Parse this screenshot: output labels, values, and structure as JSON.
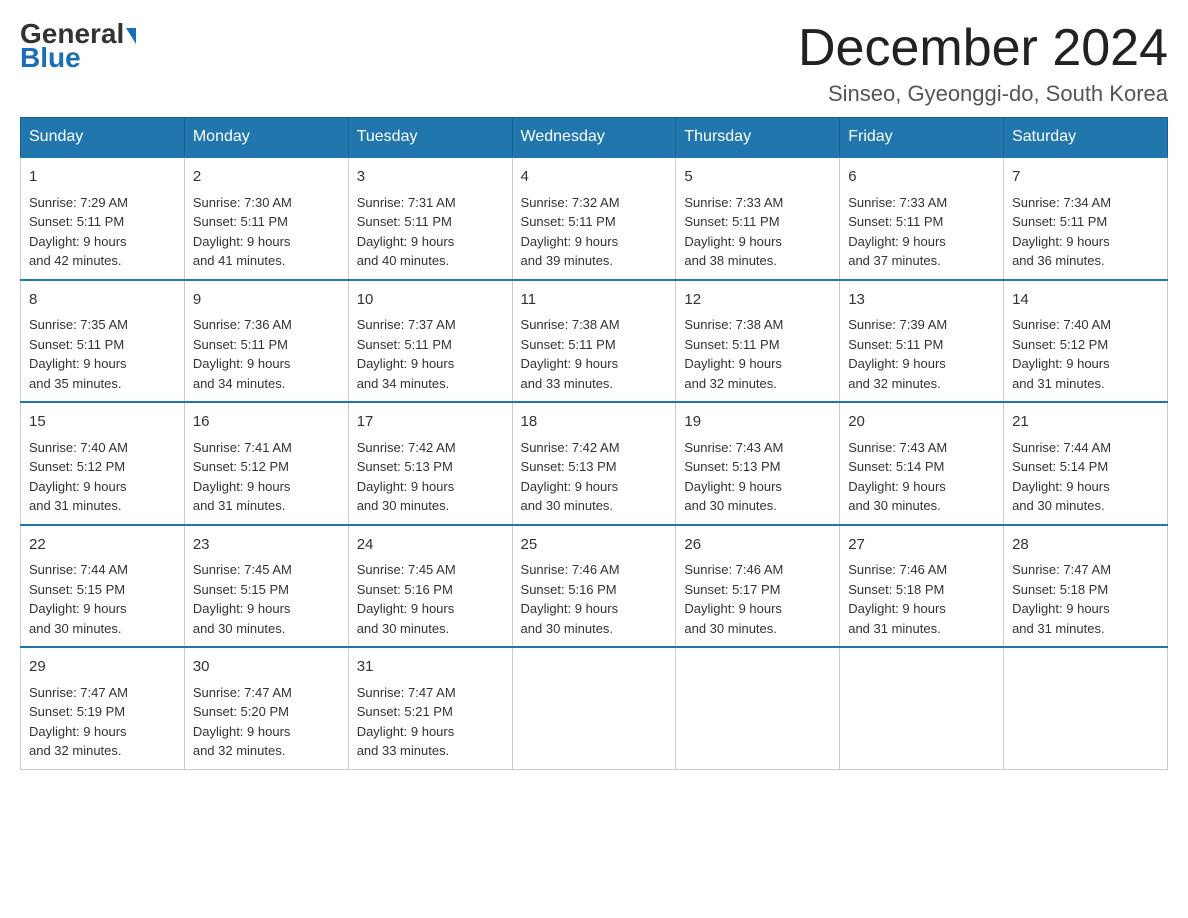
{
  "logo": {
    "general": "General",
    "blue": "Blue"
  },
  "header": {
    "month": "December 2024",
    "location": "Sinseo, Gyeonggi-do, South Korea"
  },
  "days": [
    "Sunday",
    "Monday",
    "Tuesday",
    "Wednesday",
    "Thursday",
    "Friday",
    "Saturday"
  ],
  "weeks": [
    [
      {
        "day": "1",
        "sunrise": "7:29 AM",
        "sunset": "5:11 PM",
        "daylight": "9 hours and 42 minutes."
      },
      {
        "day": "2",
        "sunrise": "7:30 AM",
        "sunset": "5:11 PM",
        "daylight": "9 hours and 41 minutes."
      },
      {
        "day": "3",
        "sunrise": "7:31 AM",
        "sunset": "5:11 PM",
        "daylight": "9 hours and 40 minutes."
      },
      {
        "day": "4",
        "sunrise": "7:32 AM",
        "sunset": "5:11 PM",
        "daylight": "9 hours and 39 minutes."
      },
      {
        "day": "5",
        "sunrise": "7:33 AM",
        "sunset": "5:11 PM",
        "daylight": "9 hours and 38 minutes."
      },
      {
        "day": "6",
        "sunrise": "7:33 AM",
        "sunset": "5:11 PM",
        "daylight": "9 hours and 37 minutes."
      },
      {
        "day": "7",
        "sunrise": "7:34 AM",
        "sunset": "5:11 PM",
        "daylight": "9 hours and 36 minutes."
      }
    ],
    [
      {
        "day": "8",
        "sunrise": "7:35 AM",
        "sunset": "5:11 PM",
        "daylight": "9 hours and 35 minutes."
      },
      {
        "day": "9",
        "sunrise": "7:36 AM",
        "sunset": "5:11 PM",
        "daylight": "9 hours and 34 minutes."
      },
      {
        "day": "10",
        "sunrise": "7:37 AM",
        "sunset": "5:11 PM",
        "daylight": "9 hours and 34 minutes."
      },
      {
        "day": "11",
        "sunrise": "7:38 AM",
        "sunset": "5:11 PM",
        "daylight": "9 hours and 33 minutes."
      },
      {
        "day": "12",
        "sunrise": "7:38 AM",
        "sunset": "5:11 PM",
        "daylight": "9 hours and 32 minutes."
      },
      {
        "day": "13",
        "sunrise": "7:39 AM",
        "sunset": "5:11 PM",
        "daylight": "9 hours and 32 minutes."
      },
      {
        "day": "14",
        "sunrise": "7:40 AM",
        "sunset": "5:12 PM",
        "daylight": "9 hours and 31 minutes."
      }
    ],
    [
      {
        "day": "15",
        "sunrise": "7:40 AM",
        "sunset": "5:12 PM",
        "daylight": "9 hours and 31 minutes."
      },
      {
        "day": "16",
        "sunrise": "7:41 AM",
        "sunset": "5:12 PM",
        "daylight": "9 hours and 31 minutes."
      },
      {
        "day": "17",
        "sunrise": "7:42 AM",
        "sunset": "5:13 PM",
        "daylight": "9 hours and 30 minutes."
      },
      {
        "day": "18",
        "sunrise": "7:42 AM",
        "sunset": "5:13 PM",
        "daylight": "9 hours and 30 minutes."
      },
      {
        "day": "19",
        "sunrise": "7:43 AM",
        "sunset": "5:13 PM",
        "daylight": "9 hours and 30 minutes."
      },
      {
        "day": "20",
        "sunrise": "7:43 AM",
        "sunset": "5:14 PM",
        "daylight": "9 hours and 30 minutes."
      },
      {
        "day": "21",
        "sunrise": "7:44 AM",
        "sunset": "5:14 PM",
        "daylight": "9 hours and 30 minutes."
      }
    ],
    [
      {
        "day": "22",
        "sunrise": "7:44 AM",
        "sunset": "5:15 PM",
        "daylight": "9 hours and 30 minutes."
      },
      {
        "day": "23",
        "sunrise": "7:45 AM",
        "sunset": "5:15 PM",
        "daylight": "9 hours and 30 minutes."
      },
      {
        "day": "24",
        "sunrise": "7:45 AM",
        "sunset": "5:16 PM",
        "daylight": "9 hours and 30 minutes."
      },
      {
        "day": "25",
        "sunrise": "7:46 AM",
        "sunset": "5:16 PM",
        "daylight": "9 hours and 30 minutes."
      },
      {
        "day": "26",
        "sunrise": "7:46 AM",
        "sunset": "5:17 PM",
        "daylight": "9 hours and 30 minutes."
      },
      {
        "day": "27",
        "sunrise": "7:46 AM",
        "sunset": "5:18 PM",
        "daylight": "9 hours and 31 minutes."
      },
      {
        "day": "28",
        "sunrise": "7:47 AM",
        "sunset": "5:18 PM",
        "daylight": "9 hours and 31 minutes."
      }
    ],
    [
      {
        "day": "29",
        "sunrise": "7:47 AM",
        "sunset": "5:19 PM",
        "daylight": "9 hours and 32 minutes."
      },
      {
        "day": "30",
        "sunrise": "7:47 AM",
        "sunset": "5:20 PM",
        "daylight": "9 hours and 32 minutes."
      },
      {
        "day": "31",
        "sunrise": "7:47 AM",
        "sunset": "5:21 PM",
        "daylight": "9 hours and 33 minutes."
      },
      null,
      null,
      null,
      null
    ]
  ],
  "labels": {
    "sunrise": "Sunrise:",
    "sunset": "Sunset:",
    "daylight": "Daylight:"
  }
}
